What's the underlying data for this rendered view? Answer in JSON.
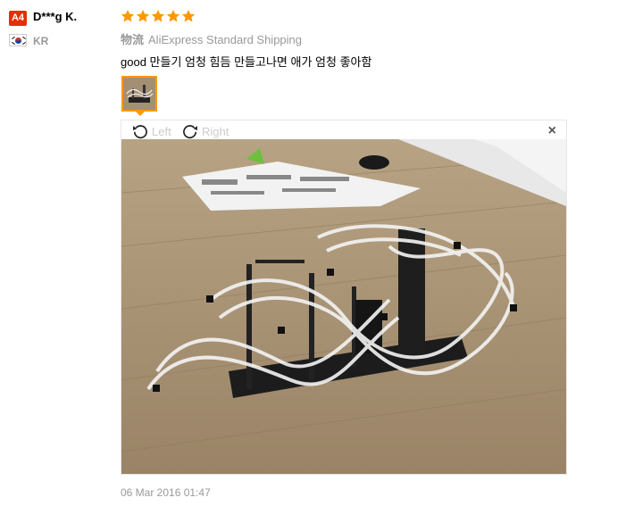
{
  "user": {
    "level": "A4",
    "name": "D***g K.",
    "country": "KR"
  },
  "review": {
    "rating": 5,
    "logistics_label": "物流",
    "shipping": "AliExpress Standard Shipping",
    "text": "good 만들기 엄청 힘듬 만들고나면 애가 엄청 좋아함",
    "date": "06 Mar 2016 01:47"
  },
  "viewer": {
    "rotate_left": "Left",
    "rotate_right": "Right",
    "close": "×"
  },
  "colors": {
    "star": "#ff9800",
    "level_badge": "#e62e04",
    "thumb_border": "#ff9900"
  }
}
